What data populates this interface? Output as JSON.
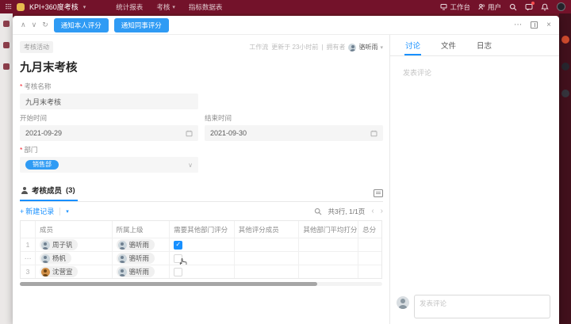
{
  "colors": {
    "topbar": "#73122a",
    "accent": "#1890ff",
    "button_blue": "#2f9bf4",
    "checked_blue": "#1890ff"
  },
  "glyphs": {
    "asterisk": "*",
    "caret_down": "▾",
    "chevron_up": "∧",
    "chevron_down": "∨",
    "refresh": "↻",
    "more": "⋯",
    "close": "×",
    "plus": "+",
    "check": "✓",
    "prev": "‹",
    "next": "›",
    "pipe": "|",
    "select_chevron": "∨"
  },
  "topbar": {
    "app_title": "KPI+360度考核",
    "menu": [
      "统计报表",
      "考核",
      "指标数据表"
    ],
    "workbench": "工作台",
    "users": "用户"
  },
  "modal_toolbar": {
    "notify_self": "通知本人评分",
    "notify_colleagues": "通知同事评分"
  },
  "record": {
    "tag": "考核活动",
    "title": "九月末考核",
    "meta": {
      "flow": "工作流",
      "updated": "更新于 23小时前",
      "owner_label": "拥有者",
      "owner_name": "骆听雨"
    },
    "fields": {
      "name_label": "考核名称",
      "name_value": "九月末考核",
      "start_label": "开始时间",
      "start_value": "2021-09-29",
      "end_label": "结束时间",
      "end_value": "2021-09-30",
      "dept_label": "部门",
      "dept_value": "销售部"
    }
  },
  "members": {
    "title": "考核成员",
    "count": "(3)",
    "new_record": "新建记录",
    "pagination": "共3行, 1/1页",
    "headers": [
      "成员",
      "所属上级",
      "需要其他部门评分",
      "其他评分成员",
      "其他部门平均打分",
      "总分"
    ],
    "rows": [
      {
        "num": "1",
        "member": "周子钒",
        "supervisor": "骆听雨",
        "needs_other_dept": true
      },
      {
        "num": "⋯",
        "member": "杨帆",
        "supervisor": "骆听雨",
        "needs_other_dept": false
      },
      {
        "num": "3",
        "member": "沈营宣",
        "supervisor": "骆听雨",
        "needs_other_dept": false
      }
    ]
  },
  "panel": {
    "tabs": [
      "讨论",
      "文件",
      "日志"
    ],
    "empty_text": "发表评论",
    "comment_placeholder": "发表评论"
  }
}
